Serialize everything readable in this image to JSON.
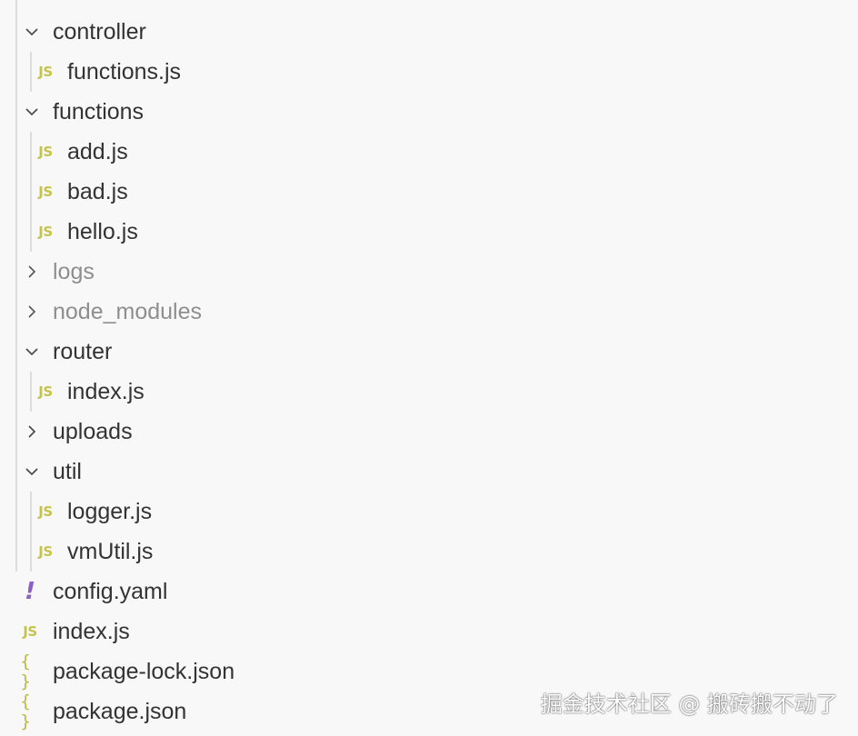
{
  "colors": {
    "background": "#f8f8f8",
    "text": "#333333",
    "muted_text": "#8e8e8e",
    "js_icon": "#c4c44c",
    "json_icon": "#b8ba45",
    "yaml_icon": "#8b5fc7",
    "guide": "#dddddd"
  },
  "tree": {
    "items": [
      {
        "label": "controller",
        "kind": "folder",
        "expanded": true,
        "icon": "chevron-down-icon"
      },
      {
        "label": "functions.js",
        "kind": "file",
        "icon": "js-file-icon",
        "icon_glyph": "JS"
      },
      {
        "label": "functions",
        "kind": "folder",
        "expanded": true,
        "icon": "chevron-down-icon"
      },
      {
        "label": "add.js",
        "kind": "file",
        "icon": "js-file-icon",
        "icon_glyph": "JS"
      },
      {
        "label": "bad.js",
        "kind": "file",
        "icon": "js-file-icon",
        "icon_glyph": "JS"
      },
      {
        "label": "hello.js",
        "kind": "file",
        "icon": "js-file-icon",
        "icon_glyph": "JS"
      },
      {
        "label": "logs",
        "kind": "folder",
        "expanded": false,
        "muted": true,
        "icon": "chevron-right-icon"
      },
      {
        "label": "node_modules",
        "kind": "folder",
        "expanded": false,
        "muted": true,
        "icon": "chevron-right-icon"
      },
      {
        "label": "router",
        "kind": "folder",
        "expanded": true,
        "icon": "chevron-down-icon"
      },
      {
        "label": "index.js",
        "kind": "file",
        "icon": "js-file-icon",
        "icon_glyph": "JS"
      },
      {
        "label": "uploads",
        "kind": "folder",
        "expanded": false,
        "icon": "chevron-right-icon"
      },
      {
        "label": "util",
        "kind": "folder",
        "expanded": true,
        "icon": "chevron-down-icon"
      },
      {
        "label": "logger.js",
        "kind": "file",
        "icon": "js-file-icon",
        "icon_glyph": "JS"
      },
      {
        "label": "vmUtil.js",
        "kind": "file",
        "icon": "js-file-icon",
        "icon_glyph": "JS"
      },
      {
        "label": "config.yaml",
        "kind": "file",
        "icon": "yaml-file-icon",
        "icon_glyph": "!"
      },
      {
        "label": "index.js",
        "kind": "file",
        "icon": "js-file-icon",
        "icon_glyph": "JS"
      },
      {
        "label": "package-lock.json",
        "kind": "file",
        "icon": "json-file-icon",
        "icon_glyph": "{ }"
      },
      {
        "label": "package.json",
        "kind": "file",
        "icon": "json-file-icon",
        "icon_glyph": "{ }"
      }
    ]
  },
  "watermark": "掘金技术社区 @ 搬砖搬不动了"
}
